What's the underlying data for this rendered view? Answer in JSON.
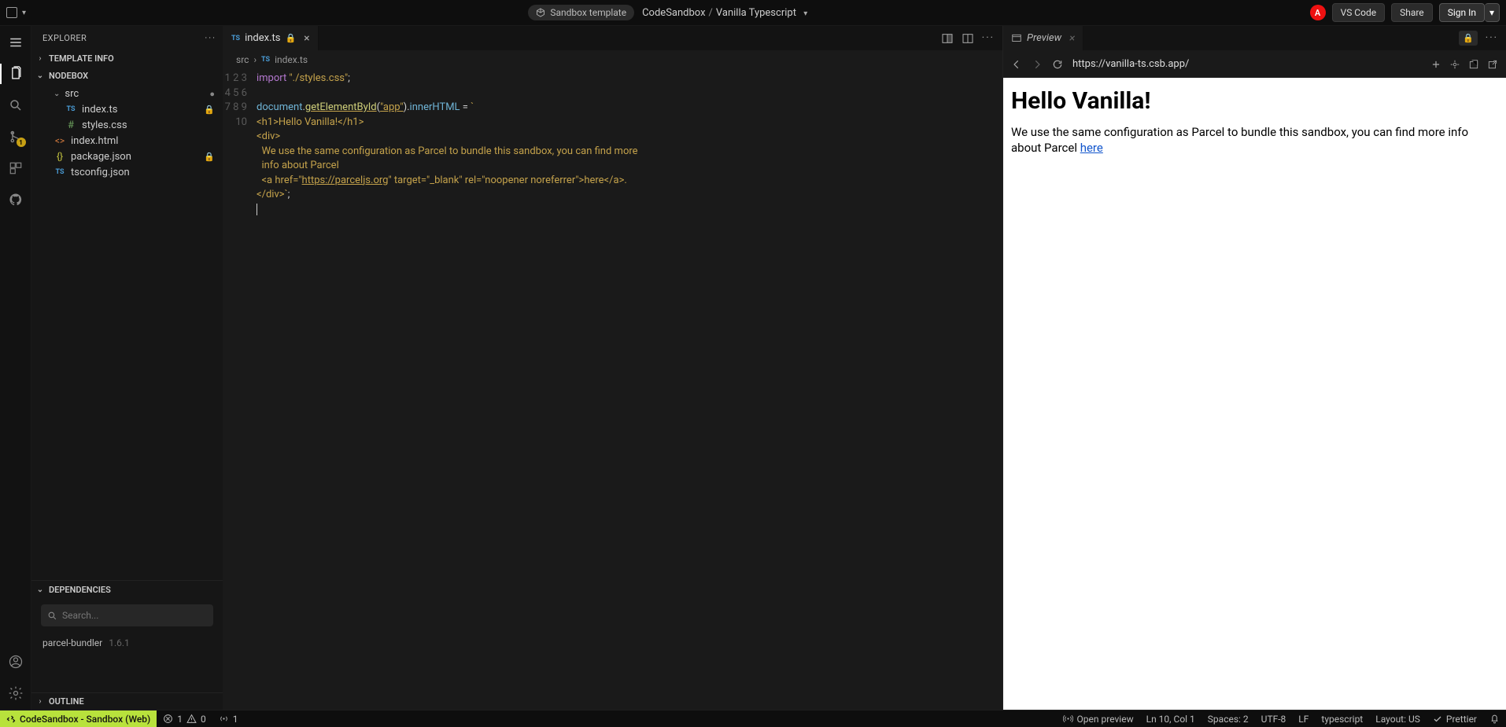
{
  "titlebar": {
    "pill": "Sandbox template",
    "crumb_org": "CodeSandbox",
    "crumb_name": "Vanilla Typescript",
    "avatar": "A",
    "btn_vscode": "VS Code",
    "btn_share": "Share",
    "btn_signin": "Sign In"
  },
  "sidebar": {
    "title": "EXPLORER",
    "sections": {
      "template_info": "TEMPLATE INFO",
      "nodebox": "NODEBOX",
      "dependencies": "DEPENDENCIES",
      "outline": "OUTLINE"
    },
    "tree": {
      "src": "src",
      "index_ts": "index.ts",
      "styles_css": "styles.css",
      "index_html": "index.html",
      "package_json": "package.json",
      "tsconfig_json": "tsconfig.json"
    },
    "search_placeholder": "Search...",
    "deps": [
      {
        "name": "parcel-bundler",
        "version": "1.6.1"
      }
    ]
  },
  "editor": {
    "tab_label": "index.ts",
    "breadcrumb": {
      "src": "src",
      "file": "index.ts"
    },
    "lines": [
      "import \"./styles.css\";",
      "",
      "document.getElementById(\"app\").innerHTML = `",
      "<h1>Hello Vanilla!</h1>",
      "<div>",
      "  We use the same configuration as Parcel to bundle this sandbox, you can find more",
      "  info about Parcel",
      "  <a href=\"https://parceljs.org\" target=\"_blank\" rel=\"noopener noreferrer\">here</a>.",
      "</div>`;",
      ""
    ]
  },
  "preview": {
    "tab_label": "Preview",
    "url": "https://vanilla-ts.csb.app/",
    "h1": "Hello Vanilla!",
    "body_text": "We use the same configuration as Parcel to bundle this sandbox, you can find more info about Parcel ",
    "link_text": "here"
  },
  "statusbar": {
    "remote": "CodeSandbox - Sandbox (Web)",
    "errors": "1",
    "warnings": "0",
    "ports": "1",
    "open_preview": "Open preview",
    "cursor": "Ln 10, Col 1",
    "spaces": "Spaces: 2",
    "encoding": "UTF-8",
    "eol": "LF",
    "lang": "typescript",
    "layout": "Layout: US",
    "prettier": "Prettier"
  }
}
